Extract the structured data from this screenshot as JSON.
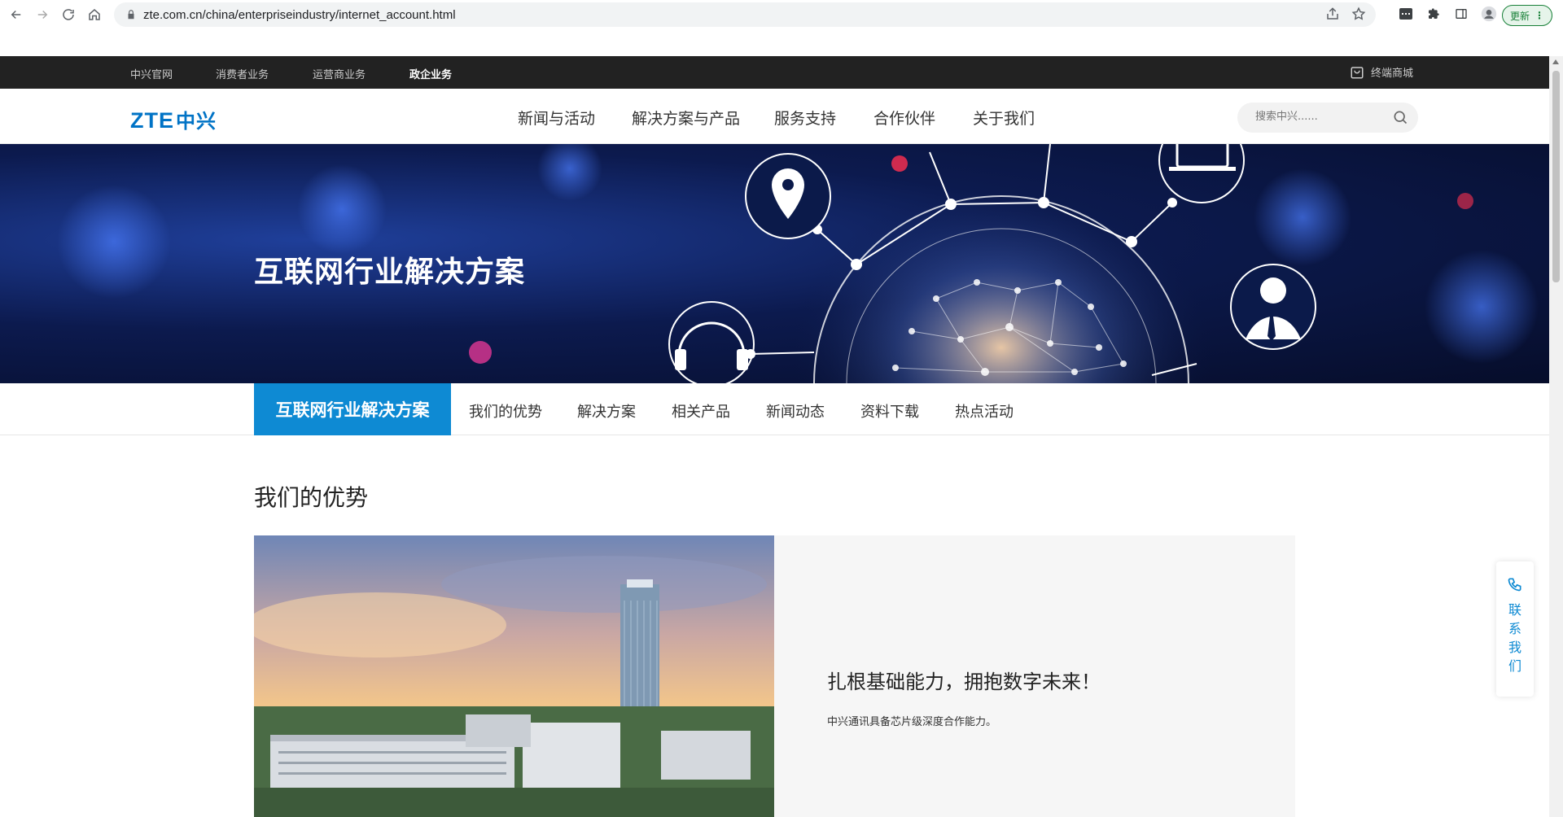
{
  "browser": {
    "url": "zte.com.cn/china/enterpriseindustry/internet_account.html",
    "update_label": "更新"
  },
  "topbar": {
    "items": [
      "中兴官网",
      "消费者业务",
      "运营商业务",
      "政企业务"
    ],
    "active_index": 3,
    "mall_label": "终端商城"
  },
  "mainnav": {
    "logo_en": "ZTE",
    "logo_cn": "中兴",
    "menu": [
      "新闻与活动",
      "解决方案与产品",
      "服务支持",
      "合作伙伴",
      "关于我们"
    ],
    "search_placeholder": "搜索中兴......"
  },
  "hero": {
    "title": "互联网行业解决方案"
  },
  "subnav": {
    "active_label": "互联网行业解决方案",
    "tabs": [
      "我们的优势",
      "解决方案",
      "相关产品",
      "新闻动态",
      "资料下载",
      "热点活动"
    ]
  },
  "main": {
    "section_title": "我们的优势",
    "card_heading": "扎根基础能力，拥抱数字未来！",
    "card_desc": "中兴通讯具备芯片级深度合作能力。"
  },
  "contact": {
    "label": "联系我们"
  },
  "colors": {
    "brand_blue": "#0073c6",
    "accent_blue": "#0e8ad3",
    "topbar_bg": "#222222"
  }
}
